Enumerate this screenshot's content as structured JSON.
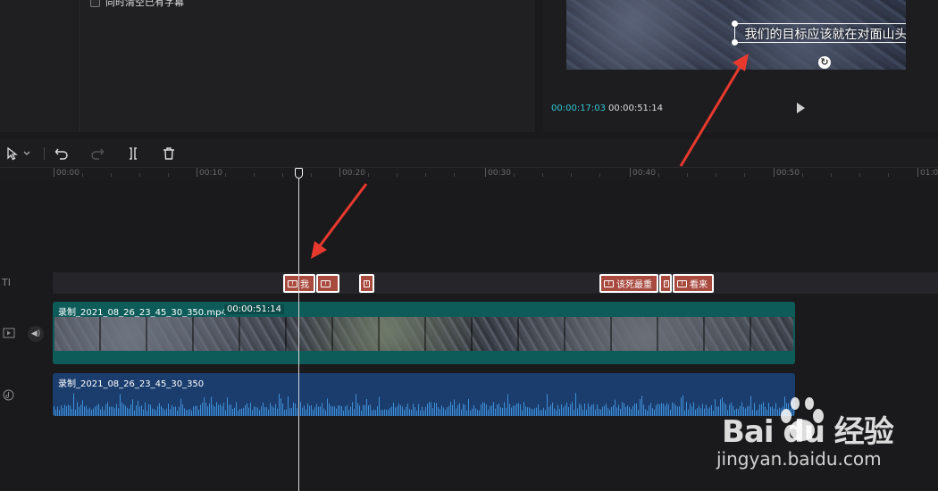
{
  "media_panel": {
    "checkbox_label": "同时清空已有字幕"
  },
  "preview": {
    "subtitle": "我们的目标应该就在对面山头",
    "time_current": "00:00:17:03",
    "time_total": "00:00:51:14"
  },
  "toolbar": {
    "select_tool": "select-icon",
    "undo": "undo-icon",
    "redo": "redo-icon",
    "split": "split-icon",
    "delete": "trash-icon"
  },
  "ruler": {
    "labels": [
      "00:00",
      "00:10",
      "00:20",
      "00:30",
      "00:40",
      "00:50",
      "01:0"
    ]
  },
  "tracks": {
    "text_track_icon": "TI",
    "text_clips": [
      {
        "label": "我"
      },
      {
        "label": ""
      },
      {
        "label": ""
      },
      {
        "label": "该死最重"
      },
      {
        "label": ""
      },
      {
        "label": "看来"
      }
    ],
    "video_clip": {
      "name": "录制_2021_08_26_23_45_30_350.mp4",
      "duration": "00:00:51:14"
    },
    "audio_clip": {
      "name": "录制_2021_08_26_23_45_30_350"
    }
  },
  "watermark": {
    "brand": "Bai du 经验",
    "url": "jingyan.baidu.com"
  },
  "colors": {
    "accent_time": "#2fc6d2",
    "text_clip": "#a94a3f",
    "video_clip": "#0d5c5a",
    "audio_clip": "#1b3d6e",
    "arrow": "#e8392e"
  }
}
